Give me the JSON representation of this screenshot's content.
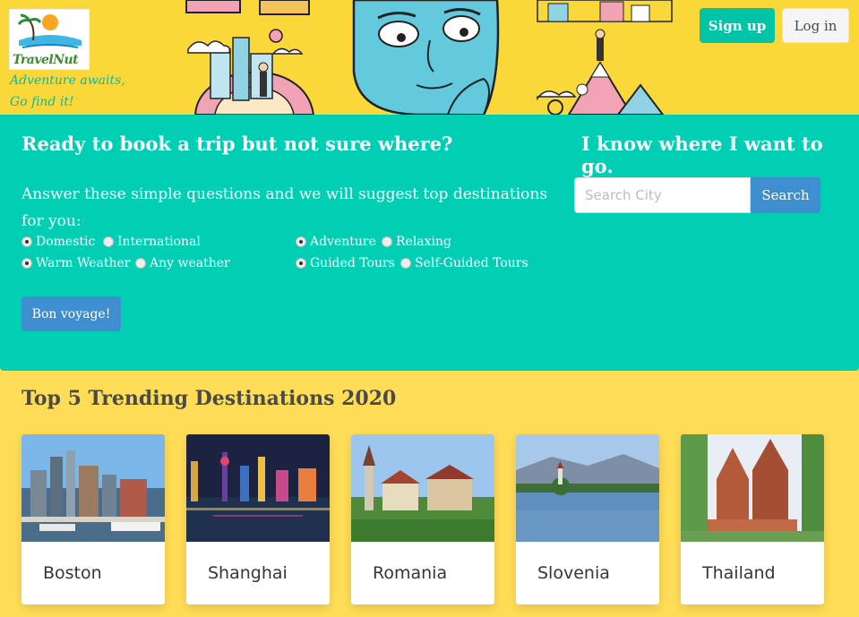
{
  "brand": {
    "logo_text": "TravelNut",
    "tagline_line1": "Adventure awaits,",
    "tagline_line2": "Go find it!"
  },
  "header": {
    "signup_label": "Sign up",
    "login_label": "Log in"
  },
  "finder": {
    "title": "Ready to book a trip but not sure where?",
    "question": "Answer these simple questions and we will suggest top destinations for you:",
    "options": [
      {
        "label": "Domestic",
        "checked": true
      },
      {
        "label": "International",
        "checked": false
      },
      {
        "label": "Adventure",
        "checked": true
      },
      {
        "label": "Relaxing",
        "checked": false
      },
      {
        "label": "Warm Weather",
        "checked": true
      },
      {
        "label": "Any weather",
        "checked": false
      },
      {
        "label": "Guided Tours",
        "checked": true
      },
      {
        "label": "Self-Guided Tours",
        "checked": false
      }
    ],
    "submit_label": "Bon voyage!"
  },
  "search": {
    "title": "I know where I want to go.",
    "placeholder": "Search City",
    "button_label": "Search"
  },
  "trending": {
    "title": "Top 5 Trending Destinations 2020",
    "destinations": [
      {
        "name": "Boston"
      },
      {
        "name": "Shanghai"
      },
      {
        "name": "Romania"
      },
      {
        "name": "Slovenia"
      },
      {
        "name": "Thailand"
      }
    ]
  },
  "colors": {
    "page_bg": "#ffdd57",
    "panel_teal": "#00cfb4",
    "primary_blue": "#3e8ed0",
    "signup_teal": "#00c4a7"
  }
}
